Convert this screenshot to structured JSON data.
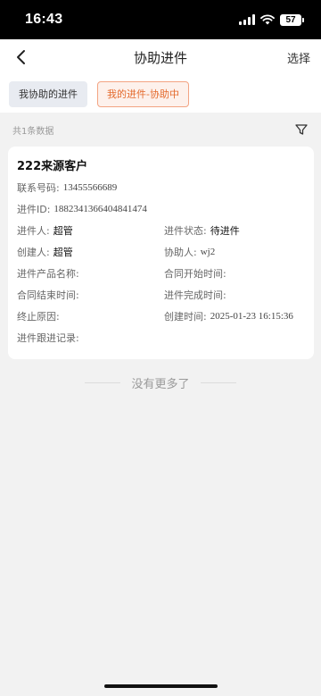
{
  "status_bar": {
    "time": "16:43",
    "battery": "57"
  },
  "nav": {
    "title": "协助进件",
    "action": "选择"
  },
  "tabs": [
    {
      "label": "我协助的进件",
      "active": false
    },
    {
      "label": "我的进件-协助中",
      "active": true
    }
  ],
  "summary": {
    "count_text": "共1条数据"
  },
  "record": {
    "title": "222来源客户",
    "phone_label": "联系号码:",
    "phone_value": "13455566689",
    "id_label": "进件ID:",
    "id_value": "1882341366404841474",
    "owner_label": "进件人:",
    "owner_value": "超管",
    "status_label": "进件状态:",
    "status_value": "待进件",
    "creator_label": "创建人:",
    "creator_value": "超管",
    "assistant_label": "协助人:",
    "assistant_value": "wj2",
    "product_label": "进件产品名称:",
    "contract_start_label": "合同开始时间:",
    "contract_end_label": "合同结束时间:",
    "complete_time_label": "进件完成时间:",
    "termination_label": "终止原因:",
    "created_time_label": "创建时间:",
    "created_time_value": "2025-01-23 16:15:36",
    "followup_label": "进件跟进记录:"
  },
  "footer": {
    "no_more": "没有更多了"
  },
  "colors": {
    "accent": "#e46a2d",
    "accent_bg": "#fdf1ec",
    "page_bg": "#f2f2f2"
  },
  "icons": {
    "back": "chevron-left-icon",
    "filter": "filter-icon",
    "wifi": "wifi-icon",
    "signal": "signal-icon",
    "battery": "battery-icon"
  }
}
